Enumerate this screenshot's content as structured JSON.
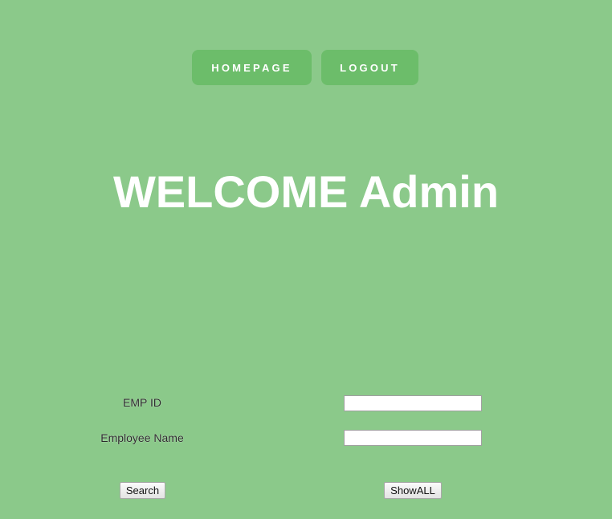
{
  "nav": {
    "homepage_label": "HOMEPAGE",
    "logout_label": "LOGOUT"
  },
  "welcome": {
    "heading": "WELCOME Admin"
  },
  "form": {
    "emp_id_label": "EMP ID",
    "emp_id_value": "",
    "employee_name_label": "Employee Name",
    "employee_name_value": "",
    "search_label": "Search",
    "showall_label": "ShowALL"
  },
  "colors": {
    "background": "#8bc98a",
    "nav_button": "#6cbd6a",
    "heading_text": "#ffffff"
  }
}
